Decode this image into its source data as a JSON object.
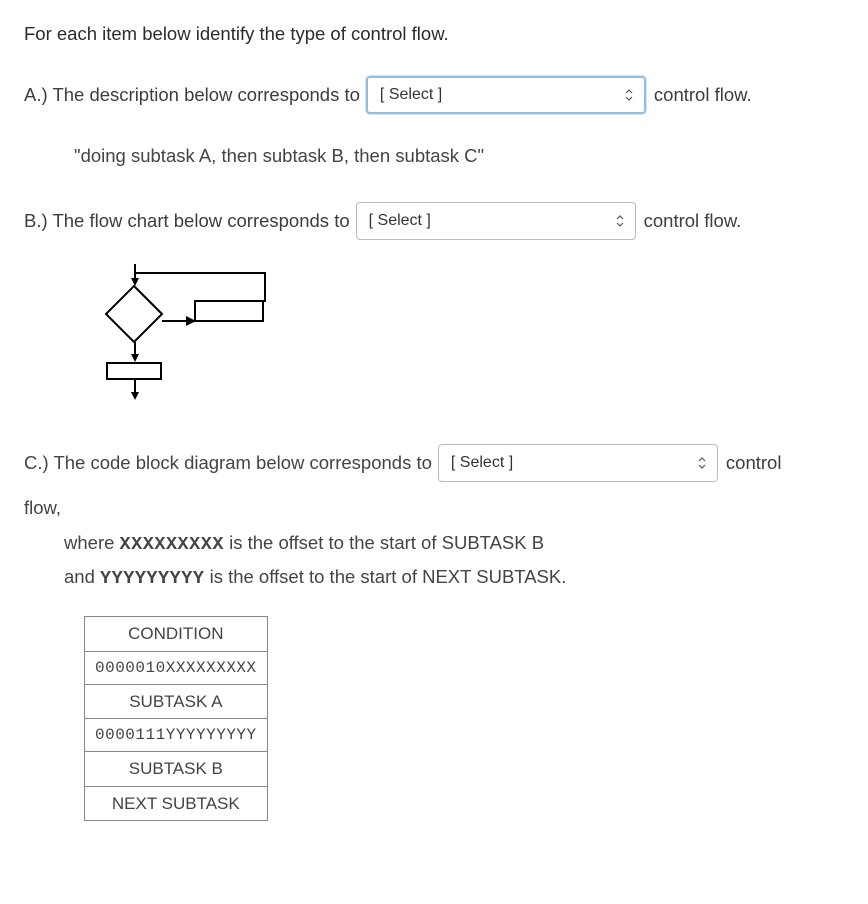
{
  "intro": "For each item below identify the type of control flow.",
  "itemA": {
    "prefix": "A.) The description below corresponds to",
    "placeholder": "[ Select ]",
    "suffix": "control flow.",
    "quote": "\"doing subtask A, then subtask B, then subtask C\""
  },
  "itemB": {
    "prefix": "B.) The flow chart below corresponds to",
    "placeholder": "[ Select ]",
    "suffix": "control flow."
  },
  "itemC": {
    "prefix": "C.) The code block diagram below corresponds to",
    "placeholder": "[ Select ]",
    "suffix": "control",
    "flowWord": "flow,",
    "where1_pre": "where ",
    "where1_mono": "XXXXXXXXX",
    "where1_post": " is the offset to the start of SUBTASK B",
    "where2_pre": "and ",
    "where2_mono": "YYYYYYYYY",
    "where2_post": " is the offset to the start of NEXT SUBTASK.",
    "table": {
      "r1": "CONDITION",
      "r2": "0000010XXXXXXXXX",
      "r3": "SUBTASK A",
      "r4": "0000111YYYYYYYYY",
      "r5": "SUBTASK B",
      "r6": "NEXT SUBTASK"
    }
  }
}
